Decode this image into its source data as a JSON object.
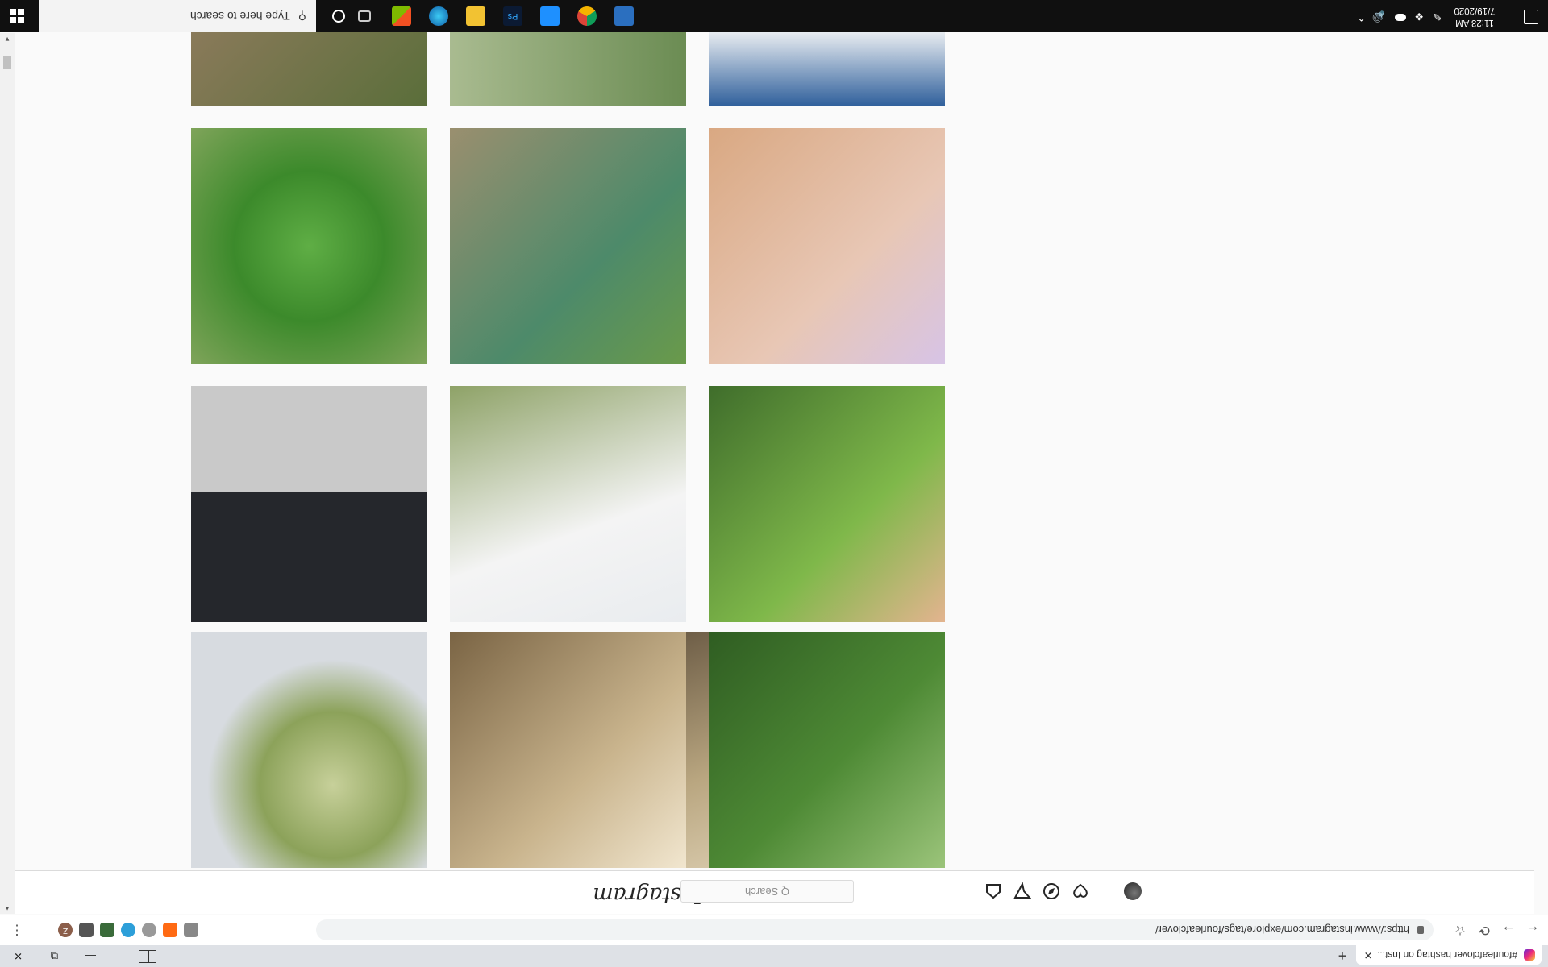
{
  "browser": {
    "tab_title": "#fourleafclover hashtag on Inst...",
    "tab_close": "✕",
    "new_tab": "+",
    "url": "https://www.instagram.com/explore/tags/fourleafclover/",
    "window_minimize": "—",
    "window_restore": "⧉",
    "window_close": "✕",
    "back": "←",
    "forward": "→",
    "reload": "⟳",
    "profile_initial": "Z"
  },
  "instagram": {
    "logo": "Instagram",
    "search_placeholder": "Q  Search"
  },
  "grid": {
    "tiles": [
      {
        "label": "clover-in-grass",
        "color": "#5a8f3c"
      },
      {
        "label": "jar-photo",
        "color": "#c8b89a"
      },
      {
        "label": "clover-pendant",
        "color": "#8c9b6a"
      },
      {
        "label": "hand-clover-toys",
        "color": "#6a8f3f"
      },
      {
        "label": "girl-with-clover",
        "color": "#8aa46a"
      },
      {
        "label": "black-charm",
        "color": "#2f3035"
      },
      {
        "label": "woman-selfie",
        "color": "#d9b9a7"
      },
      {
        "label": "clover-collage",
        "color": "#4f7d3c"
      },
      {
        "label": "big-clover-closeup",
        "color": "#4c9a3a"
      },
      {
        "label": "sky-illustration",
        "color": "#3e6fa8"
      },
      {
        "label": "trees-collage",
        "color": "#6d8b59"
      },
      {
        "label": "clover-ground",
        "color": "#5b6e3a"
      }
    ]
  },
  "taskbar": {
    "search_placeholder": "Type here to search",
    "time": "11:23 AM",
    "date": "7/19/2020"
  }
}
